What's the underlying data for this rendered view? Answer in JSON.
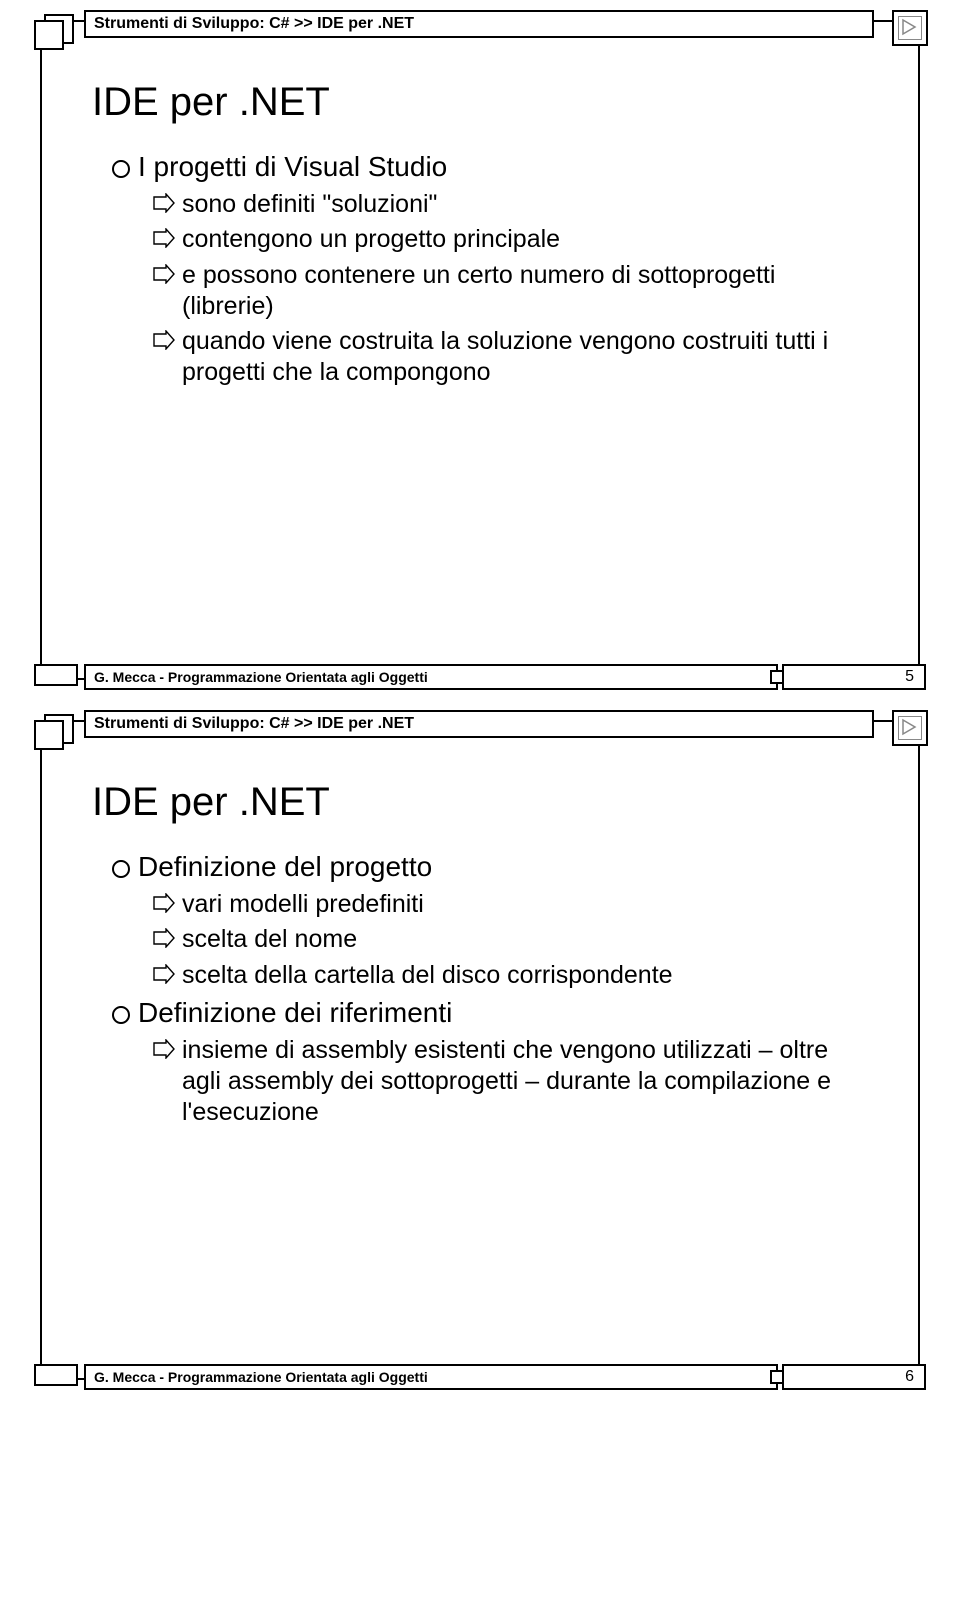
{
  "slides": [
    {
      "breadcrumb": "Strumenti di Sviluppo: C# >> IDE per .NET",
      "title": "IDE per .NET",
      "bullets": [
        {
          "level": 1,
          "text": "I progetti di Visual Studio"
        },
        {
          "level": 2,
          "text": "sono definiti \"soluzioni\""
        },
        {
          "level": 2,
          "text": "contengono un progetto principale"
        },
        {
          "level": 2,
          "text": "e possono contenere un certo numero di sottoprogetti (librerie)"
        },
        {
          "level": 2,
          "text": "quando viene costruita la soluzione vengono costruiti tutti i progetti che la compongono"
        }
      ],
      "footer": "G. Mecca - Programmazione Orientata agli Oggetti",
      "page": "5"
    },
    {
      "breadcrumb": "Strumenti di Sviluppo: C# >> IDE per .NET",
      "title": "IDE per .NET",
      "bullets": [
        {
          "level": 1,
          "text": "Definizione del progetto"
        },
        {
          "level": 2,
          "text": "vari modelli predefiniti"
        },
        {
          "level": 2,
          "text": "scelta del nome"
        },
        {
          "level": 2,
          "text": "scelta della cartella del disco corrispondente"
        },
        {
          "level": 1,
          "text": "Definizione dei riferimenti"
        },
        {
          "level": 2,
          "text": "insieme di assembly esistenti che vengono utilizzati – oltre agli assembly dei sottoprogetti – durante la compilazione e l'esecuzione"
        }
      ],
      "footer": "G. Mecca - Programmazione Orientata agli Oggetti",
      "page": "6"
    }
  ]
}
